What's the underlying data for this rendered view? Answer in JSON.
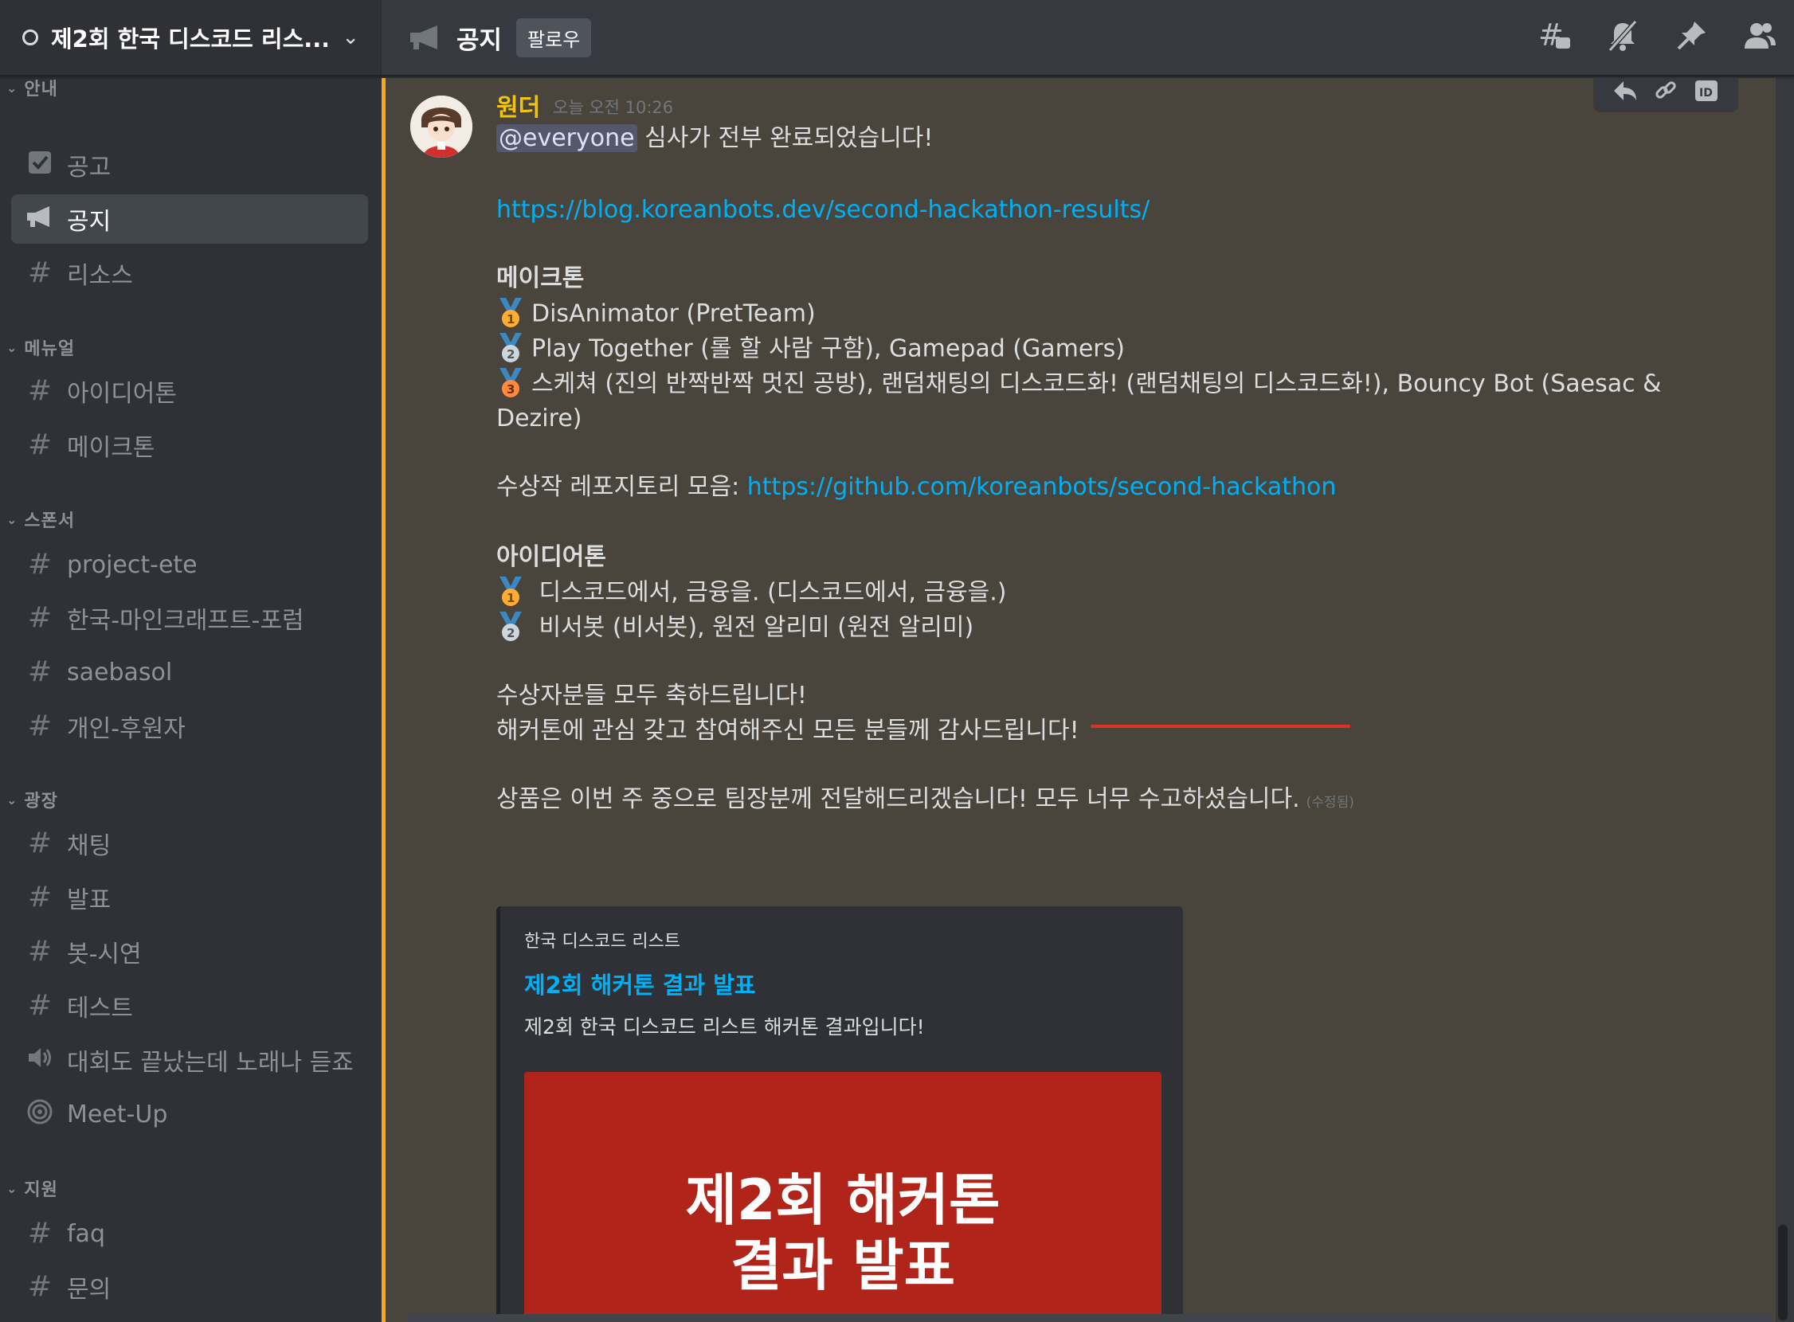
{
  "server": {
    "name": "제2회 한국 디스코드 리스..."
  },
  "sidebar": {
    "categories": [
      {
        "name": "안내",
        "channels": [
          {
            "name": "공고",
            "icon": "rules-checkbox-icon"
          },
          {
            "name": "공지",
            "icon": "announcement-megaphone-icon",
            "active": true
          },
          {
            "name": "리소스",
            "icon": "hashtag-icon"
          }
        ]
      },
      {
        "name": "메뉴얼",
        "channels": [
          {
            "name": "아이디어톤",
            "icon": "hashtag-icon"
          },
          {
            "name": "메이크톤",
            "icon": "hashtag-icon"
          }
        ]
      },
      {
        "name": "스폰서",
        "channels": [
          {
            "name": "project-ete",
            "icon": "hashtag-icon"
          },
          {
            "name": "한국-마인크래프트-포럼",
            "icon": "hashtag-icon"
          },
          {
            "name": "saebasol",
            "icon": "hashtag-icon"
          },
          {
            "name": "개인-후원자",
            "icon": "hashtag-icon"
          }
        ]
      },
      {
        "name": "광장",
        "channels": [
          {
            "name": "채팅",
            "icon": "hashtag-icon"
          },
          {
            "name": "발표",
            "icon": "hashtag-icon"
          },
          {
            "name": "봇-시연",
            "icon": "hashtag-icon"
          },
          {
            "name": "테스트",
            "icon": "hashtag-icon"
          },
          {
            "name": "대회도 끝났는데 노래나 듣죠",
            "icon": "speaker-icon"
          },
          {
            "name": "Meet-Up",
            "icon": "stage-icon"
          }
        ]
      },
      {
        "name": "지원",
        "channels": [
          {
            "name": "faq",
            "icon": "hashtag-icon"
          },
          {
            "name": "문의",
            "icon": "hashtag-icon"
          }
        ]
      }
    ]
  },
  "topbar": {
    "channel_name": "공지",
    "follow_label": "팔로우",
    "icons": [
      "threads-icon",
      "mute-bell-icon",
      "pin-icon",
      "member-list-icon"
    ]
  },
  "message": {
    "author": "원더",
    "author_color": "#f1c40f",
    "timestamp": "오늘 오전 10:26",
    "mention": "@everyone",
    "line1_text": " 심사가 전부 완료되었습니다!",
    "blog_link": "https://blog.koreanbots.dev/second-hackathon-results/",
    "makethon_heading": "메이크톤",
    "makethon_first": "DisAnimator (PretTeam)",
    "makethon_second": "Play Together (롤 할 사람 구함), Gamepad (Gamers)",
    "makethon_third_a": "스케쳐 (진의 반짝반짝 멋진 공방), 랜덤채팅의 디스코드화! (랜덤채팅의 디스코드화!), Bouncy Bot (Saesac &",
    "makethon_third_b": "Dezire)",
    "repo_label": "수상작 레포지토리 모음: ",
    "repo_link": "https://github.com/koreanbots/second-hackathon",
    "ideathon_heading": "아이디어톤",
    "ideathon_first": "디스코드에서, 금융을. (디스코드에서, 금융을.)",
    "ideathon_second": "비서봇 (비서봇), 원전 알리미 (원전 알리미)",
    "congrats": "수상자분들 모두 축하드립니다!",
    "thanks": "해커톤에 관심 갖고 참여해주신 모든 분들께 감사드립니다!",
    "prize": "상품은 이번 주 중으로 팀장분께 전달해드리겠습니다! 모두 너무 수고하셨습니다.",
    "edited": "(수정됨)"
  },
  "embed": {
    "provider": "한국 디스코드 리스트",
    "title": "제2회 해커톤 결과 발표",
    "description": "제2회 한국 디스코드 리스트 해커톤 결과입니다!",
    "image_line1": "제2회 해커톤",
    "image_line2": "결과 발표",
    "image_color": "#b0241a"
  },
  "toolbar_icons": [
    "reply-icon",
    "copy-link-icon",
    "copy-id-icon"
  ],
  "colors": {
    "accent_highlight": "#faa61a",
    "link": "#00b0f4",
    "underline": "#e0301e"
  }
}
